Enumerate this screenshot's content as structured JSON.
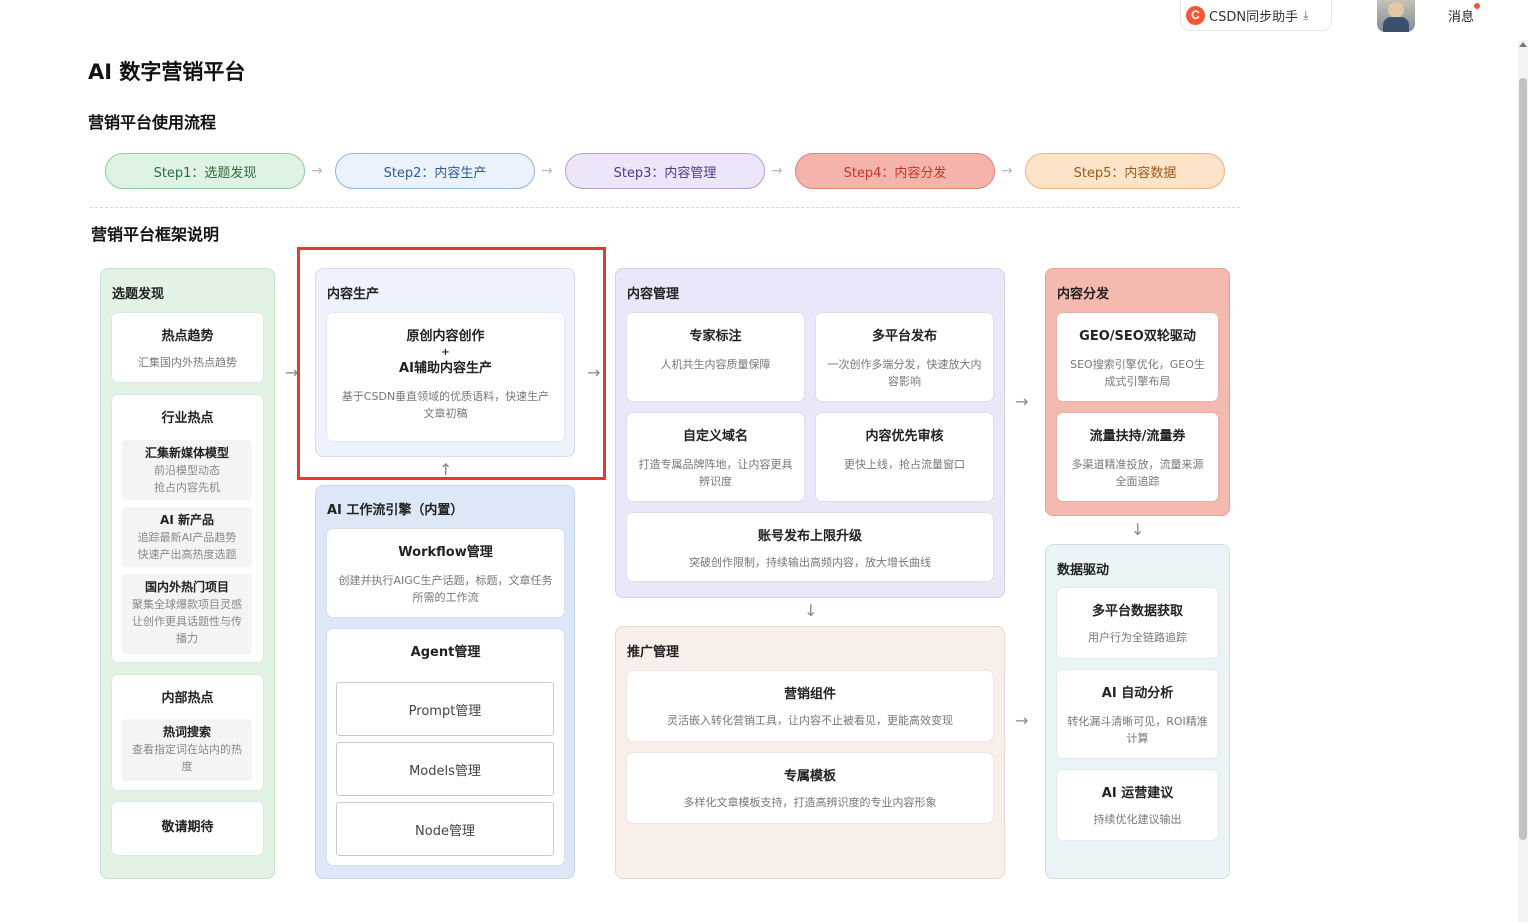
{
  "topbar": {
    "helper_logo": "C",
    "helper_label": "CSDN同步助手",
    "helper_icon": "download-icon",
    "message_label": "消息"
  },
  "page_title": "AI 数字营销平台",
  "flow_title": "营销平台使用流程",
  "framework_title": "营销平台框架说明",
  "steps": [
    {
      "label": "Step1：选题发现",
      "bg": "#dff3e4",
      "border": "#8ccf9f",
      "color": "#2e6b3f"
    },
    {
      "label": "Step2：内容生产",
      "bg": "#ebf2fc",
      "border": "#8eb3e6",
      "color": "#2f5c96"
    },
    {
      "label": "Step3：内容管理",
      "bg": "#ece6f8",
      "border": "#b39ddb",
      "color": "#4f3c87"
    },
    {
      "label": "Step4：内容分发",
      "bg": "#f4b4ab",
      "border": "#e57f73",
      "color": "#c0392b"
    },
    {
      "label": "Step5：内容数据",
      "bg": "#fde3c8",
      "border": "#f0b27a",
      "color": "#9a5a1f"
    }
  ],
  "topic": {
    "title": "选题发现",
    "hot_trend": {
      "title": "热点趋势",
      "desc": "汇集国内外热点趋势"
    },
    "industry": {
      "title": "行业热点",
      "items": [
        {
          "title": "汇集新媒体模型",
          "desc1": "前沿模型动态",
          "desc2": "抢占内容先机"
        },
        {
          "title": "AI 新产品",
          "desc1": "追踪最新AI产品趋势",
          "desc2": "快速产出高热度选题"
        },
        {
          "title": "国内外热门项目",
          "desc1": "聚集全球爆款项目灵感",
          "desc2": "让创作更具话题性与传",
          "desc3": "播力"
        }
      ]
    },
    "internal": {
      "title": "内部热点",
      "item": {
        "title": "热词搜索",
        "desc1": "查看指定词在站内的热",
        "desc2": "度"
      }
    },
    "coming": "敬请期待"
  },
  "production": {
    "title": "内容生产",
    "card": {
      "line1": "原创内容创作",
      "plus": "+",
      "line2": "AI辅助内容生产",
      "desc1": "基于CSDN垂直领域的优质语料，快速生产",
      "desc2": "文章初稿"
    }
  },
  "workflow": {
    "title": "AI 工作流引擎（内置）",
    "wf": {
      "title": "Workflow管理",
      "desc1": "创建并执行AIGC生产话题，标题，文章任务",
      "desc2": "所需的工作流"
    },
    "agent": {
      "title": "Agent管理",
      "prompt": "Prompt管理",
      "models": "Models管理",
      "node": "Node管理"
    }
  },
  "management": {
    "title": "内容管理",
    "expert": {
      "title": "专家标注",
      "desc": "人机共生内容质量保障"
    },
    "multi": {
      "title": "多平台发布",
      "desc1": "一次创作多端分发，快速放大内",
      "desc2": "容影响"
    },
    "domain": {
      "title": "自定义域名",
      "desc1": "打造专属品牌阵地，让内容更具",
      "desc2": "辨识度"
    },
    "review": {
      "title": "内容优先审核",
      "desc": "更快上线，抢占流量窗口"
    },
    "account": {
      "title": "账号发布上限升级",
      "desc": "突破创作限制，持续输出高频内容，放大增长曲线"
    }
  },
  "promotion": {
    "title": "推广管理",
    "component": {
      "title": "营销组件",
      "desc": "灵活嵌入转化营销工具，让内容不止被看见，更能高效变现"
    },
    "template": {
      "title": "专属模板",
      "desc": "多样化文章模板支持，打造高辨识度的专业内容形象"
    }
  },
  "distribution": {
    "title": "内容分发",
    "geo": {
      "title": "GEO/SEO双轮驱动",
      "desc1": "SEO搜索引擎优化，GEO生",
      "desc2": "成式引擎布局"
    },
    "traffic": {
      "title": "流量扶持/流量券",
      "desc1": "多渠道精准投放，流量来源",
      "desc2": "全面追踪"
    }
  },
  "data_driven": {
    "title": "数据驱动",
    "fetch": {
      "title": "多平台数据获取",
      "desc": "用户行为全链路追踪"
    },
    "analysis": {
      "title": "AI 自动分析",
      "desc1": "转化漏斗清晰可见，ROI精准",
      "desc2": "计算"
    },
    "advice": {
      "title": "AI 运营建议",
      "desc": "持续优化建议输出"
    }
  },
  "arrows": {
    "right": "→",
    "down": "↓",
    "up": "↑"
  }
}
